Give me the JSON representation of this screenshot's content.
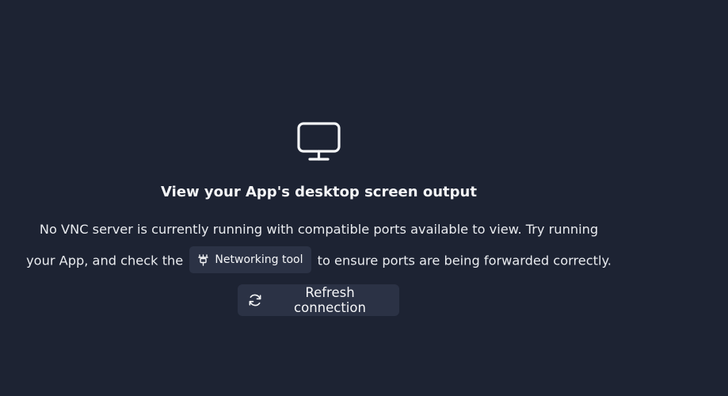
{
  "empty_state": {
    "icon": "monitor-icon",
    "title": "View your App's desktop screen output",
    "description_line1": "No VNC server is currently running with compatible ports available to view. Try running",
    "description_line2_before": "your App, and check the",
    "networking_tool": {
      "icon": "network-icon",
      "label": "Networking tool"
    },
    "description_line2_after": "to ensure ports are being forwarded correctly."
  },
  "refresh_button": {
    "icon": "refresh-icon",
    "label": "Refresh connection"
  },
  "colors": {
    "background": "#1d2333",
    "surface": "#2b3245",
    "text": "#f5f6f8"
  }
}
